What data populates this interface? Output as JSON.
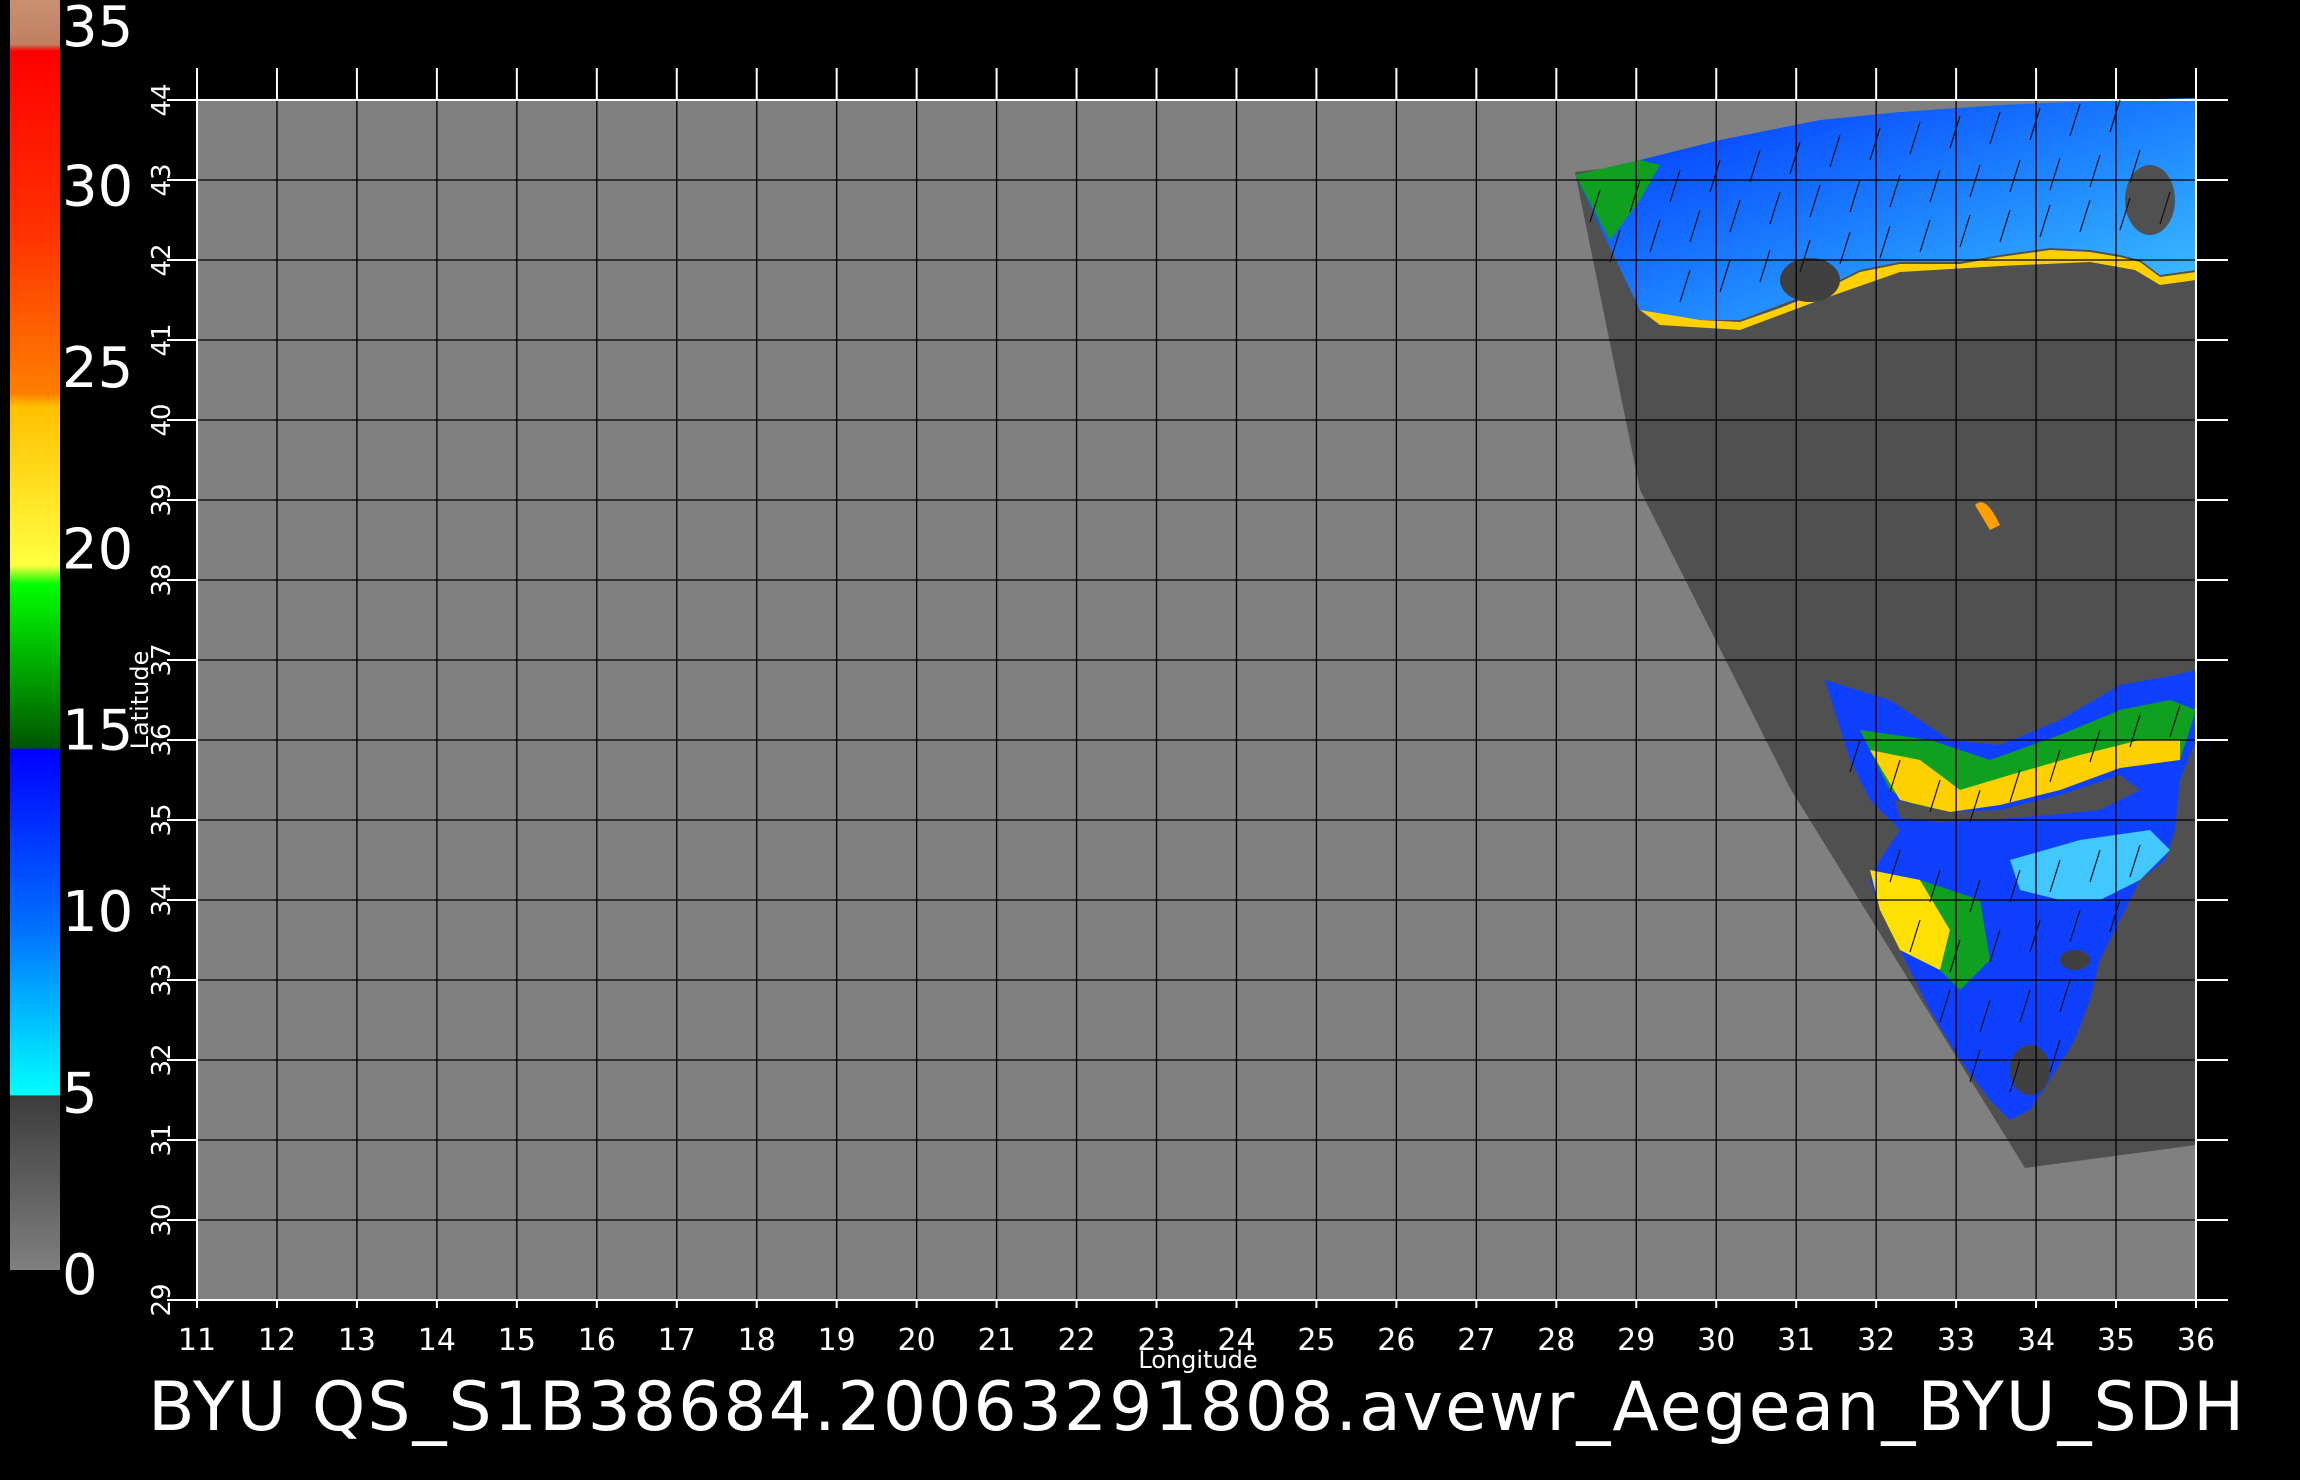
{
  "title": "BYU  QS_S1B38684.20063291808.avewr_Aegean_BYU_SDH",
  "x_axis": {
    "label": "Longitude",
    "ticks": [
      "11",
      "12",
      "13",
      "14",
      "15",
      "16",
      "17",
      "18",
      "19",
      "20",
      "21",
      "22",
      "23",
      "24",
      "25",
      "26",
      "27",
      "28",
      "29",
      "30",
      "31",
      "32",
      "33",
      "34",
      "35",
      "36"
    ]
  },
  "y_axis": {
    "label": "Latitude",
    "ticks": [
      "29",
      "30",
      "31",
      "32",
      "33",
      "34",
      "35",
      "36",
      "37",
      "38",
      "39",
      "40",
      "41",
      "42",
      "43",
      "44"
    ]
  },
  "colorbar": {
    "labels": [
      "0",
      "5",
      "10",
      "15",
      "20",
      "25",
      "30",
      "35"
    ],
    "colors": {
      "gray_low": "#7f7f7f",
      "gray_high": "#3a3a3a",
      "cyan": "#00ffff",
      "blue": "#0000ff",
      "green": "#00ff00",
      "dark_green": "#006600",
      "yellow": "#ffff00",
      "orange": "#ff7f00",
      "red": "#ff0000",
      "tan": "#c08060"
    }
  },
  "map": {
    "background_color": "#808080",
    "no_data_color": "#505050",
    "lon_range": [
      11,
      36
    ],
    "lat_range": [
      29,
      44
    ]
  }
}
